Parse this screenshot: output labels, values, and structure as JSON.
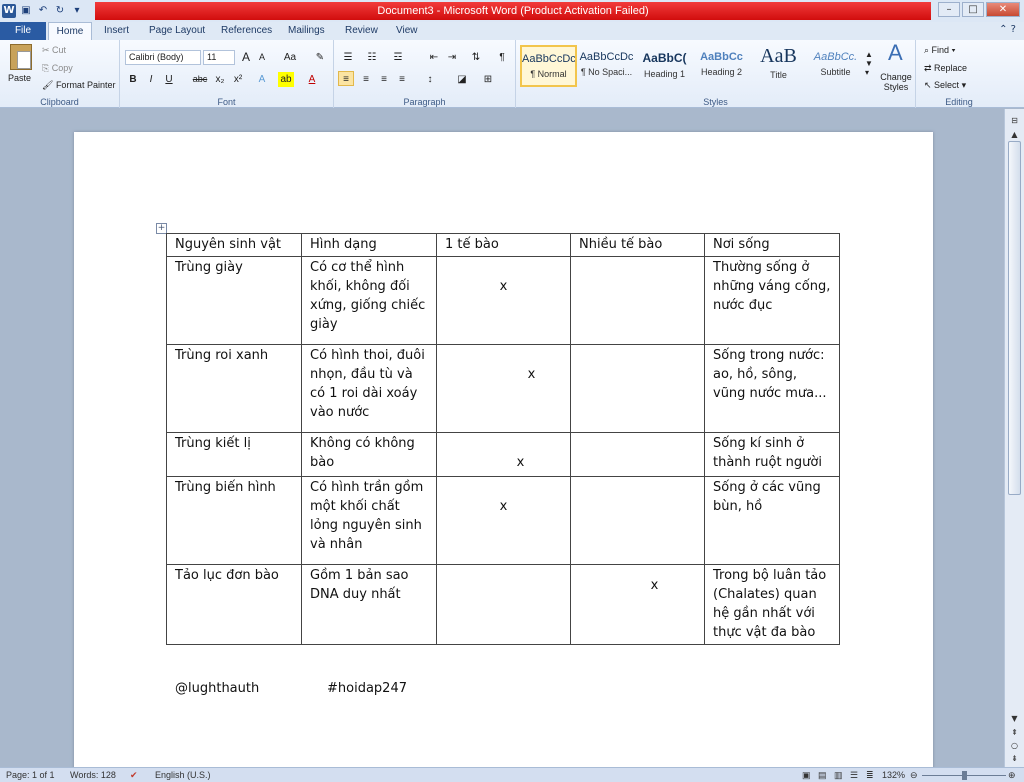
{
  "window": {
    "title": "Document3 - Microsoft Word (Product Activation Failed)"
  },
  "tabs": [
    "File",
    "Home",
    "Insert",
    "Page Layout",
    "References",
    "Mailings",
    "Review",
    "View"
  ],
  "clipboard": {
    "paste": "Paste",
    "cut": "Cut",
    "copy": "Copy",
    "format_painter": "Format Painter",
    "label": "Clipboard"
  },
  "font": {
    "name": "Calibri (Body)",
    "size": "11",
    "grow": "A",
    "shrink": "A",
    "change_case": "Aa",
    "bold": "B",
    "italic": "I",
    "underline": "U",
    "strike": "abc",
    "subscript": "x₂",
    "superscript": "x²",
    "label": "Font"
  },
  "paragraph": {
    "label": "Paragraph"
  },
  "styles": {
    "items": [
      {
        "sample": "AaBbCcDc",
        "name": "¶ Normal"
      },
      {
        "sample": "AaBbCcDc",
        "name": "¶ No Spaci..."
      },
      {
        "sample": "AaBbC(",
        "name": "Heading 1"
      },
      {
        "sample": "AaBbCc",
        "name": "Heading 2"
      },
      {
        "sample": "AaB",
        "name": "Title"
      },
      {
        "sample": "AaBbCc.",
        "name": "Subtitle"
      }
    ],
    "change_styles": "Change Styles",
    "label": "Styles"
  },
  "editing": {
    "find": "Find",
    "replace": "Replace",
    "select": "Select",
    "label": "Editing"
  },
  "table": {
    "headers": [
      "Nguyên sinh vật",
      "Hình dạng",
      "1 tế bào",
      "Nhiều tế bào",
      "Nơi sống"
    ],
    "rows": [
      {
        "name": "Trùng giày",
        "shape": "Có cơ thể hình khối, không đối xứng, giống chiếc giày",
        "one_cell": "x",
        "multi_cell": "",
        "habitat": "Thường sống ở những váng cống, nước đục"
      },
      {
        "name": "Trùng roi xanh",
        "shape": "Có hình thoi, đuôi nhọn, đầu tù và có 1 roi dài xoáy vào nước",
        "one_cell": "x",
        "multi_cell": "",
        "habitat": "Sống trong nước: ao, hồ, sông, vũng nước mưa..."
      },
      {
        "name": "Trùng kiết lị",
        "shape": "Không có không bào",
        "one_cell": "x",
        "multi_cell": "",
        "habitat": "Sống kí sinh ở thành ruột người"
      },
      {
        "name": "Trùng biến hình",
        "shape": "Có hình trần gồm một khối chất lỏng nguyên sinh và nhân",
        "one_cell": "x",
        "multi_cell": "",
        "habitat": "Sống ở các vũng bùn, hồ"
      },
      {
        "name": "Tảo lục đơn bào",
        "shape": "Gồm 1 bản sao DNA duy nhất",
        "one_cell": "",
        "multi_cell": "x",
        "habitat": "Trong bộ luân tảo (Chalates) quan hệ gần nhất với thực vật đa bào"
      }
    ]
  },
  "footer": {
    "author": "@lughthauth",
    "tag": "#hoidap247"
  },
  "status": {
    "page": "Page: 1 of 1",
    "words": "Words: 128",
    "language": "English (U.S.)",
    "zoom": "132%"
  }
}
